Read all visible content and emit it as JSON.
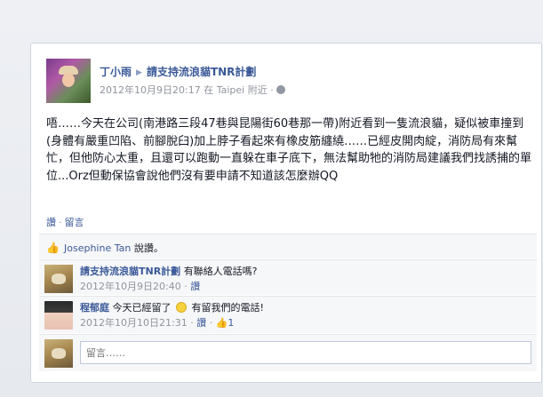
{
  "post": {
    "author": "丁小雨",
    "target": "請支持流浪貓TNR計劃",
    "timestamp": "2012年10月9日20:17",
    "location_prefix": "在",
    "location": "Taipei 附近",
    "text": "唔……今天在公司(南港路三段47巷與昆陽街60巷那一帶)附近看到一隻流浪貓，疑似被車撞到(身體有嚴重凹陷、前腳脫臼)加上脖子看起來有橡皮筋纏繞……已經皮開肉綻，消防局有來幫忙，但他防心太重，且還可以跑動一直躲在車子底下，無法幫助牠的消防局建議我們找誘捕的單位...Orz但動保協會說他們沒有要申請不知道該怎麼辦QQ",
    "actions": {
      "like": "讚",
      "comment": "留言"
    }
  },
  "likes": {
    "name": "Josephine Tan",
    "suffix": "說讚。"
  },
  "comments": [
    {
      "author": "請支持流浪貓TNR計劃",
      "text": "有聯絡人電話嗎?",
      "timestamp": "2012年10月9日20:40",
      "like": "讚"
    },
    {
      "author": "程郁庭",
      "text_before": "今天已經留了",
      "text_after": "有留我們的電話!",
      "timestamp": "2012年10月10日21:31",
      "like": "讚",
      "like_count": "1"
    }
  ],
  "composer": {
    "placeholder": "留言……"
  },
  "icons": {
    "thumb": "thumbs-up-icon",
    "globe": "globe-icon",
    "arrow": "arrow-right-icon",
    "smile": "smiley-icon"
  }
}
